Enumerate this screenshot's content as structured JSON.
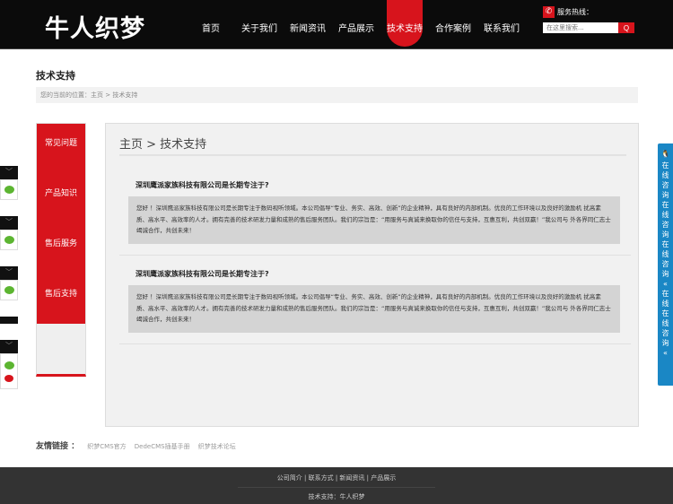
{
  "header": {
    "logo": "牛人织梦",
    "nav": [
      "首页",
      "关于我们",
      "新闻资讯",
      "产品展示",
      "技术支持",
      "合作案例",
      "联系我们"
    ],
    "active_index": 4,
    "hotline_label": "服务热线：",
    "search_placeholder": "在这里搜索...",
    "search_icon": "Q"
  },
  "page_title": "技术支持",
  "breadcrumb": "您的当前的位置：主页 > 技术支持",
  "sidebar": [
    "常见问题",
    "产品知识",
    "售后服务",
    "售后支持"
  ],
  "main": {
    "heading": "主页 > 技术支持",
    "items": [
      {
        "q": "深圳鹰派家族科技有限公司是长期专注于?",
        "a": "您好 ！深圳鹰派家族科技有限公司是长期专注于数码视听领域。本公司倡导“专业、务实、高效、创新”的企业精神，具有良好的内部机制。优良的工作环境以及良好的激励机 扰高素质、高水平、高效率的人才。拥有完善的技术研发力量和成熟的售后服务团队。我们的宗旨是：“用服务与真诚来换取你的信任与支持，互惠互利，共创双赢！”我公司与 外各界同仁志士竭诚合作，共创未来！"
      },
      {
        "q": "深圳鹰派家族科技有限公司是长期专注于?",
        "a": "您好 ！深圳鹰派家族科技有限公司是长期专注于数码视听领域。本公司倡导“专业、务实、高效、创新”的企业精神，具有良好的内部机制。优良的工作环境以及良好的激励机 扰高素质、高水平、高效率的人才。拥有完善的技术研发力量和成熟的售后服务团队。我们的宗旨是：“用服务与真诚来换取你的信任与支持，互惠互利，共创双赢！”我公司与 外各界同仁志士竭诚合作，共创未来！"
      }
    ]
  },
  "friends": {
    "label": "友情链接 ：",
    "links": [
      "织梦CMS官方",
      "DedeCMS插基手册",
      "织梦技术论坛"
    ]
  },
  "footer": {
    "links": "公司简介 | 联系方式 | 新闻资讯 | 产品展示",
    "copy": "技术支持：牛人织梦"
  },
  "qq_bar": "在线咨询 在线咨询 在线咨询 « 在线 在线咨询 «",
  "colors": {
    "brand": "#d7141c",
    "qq": "#1a87c5"
  }
}
